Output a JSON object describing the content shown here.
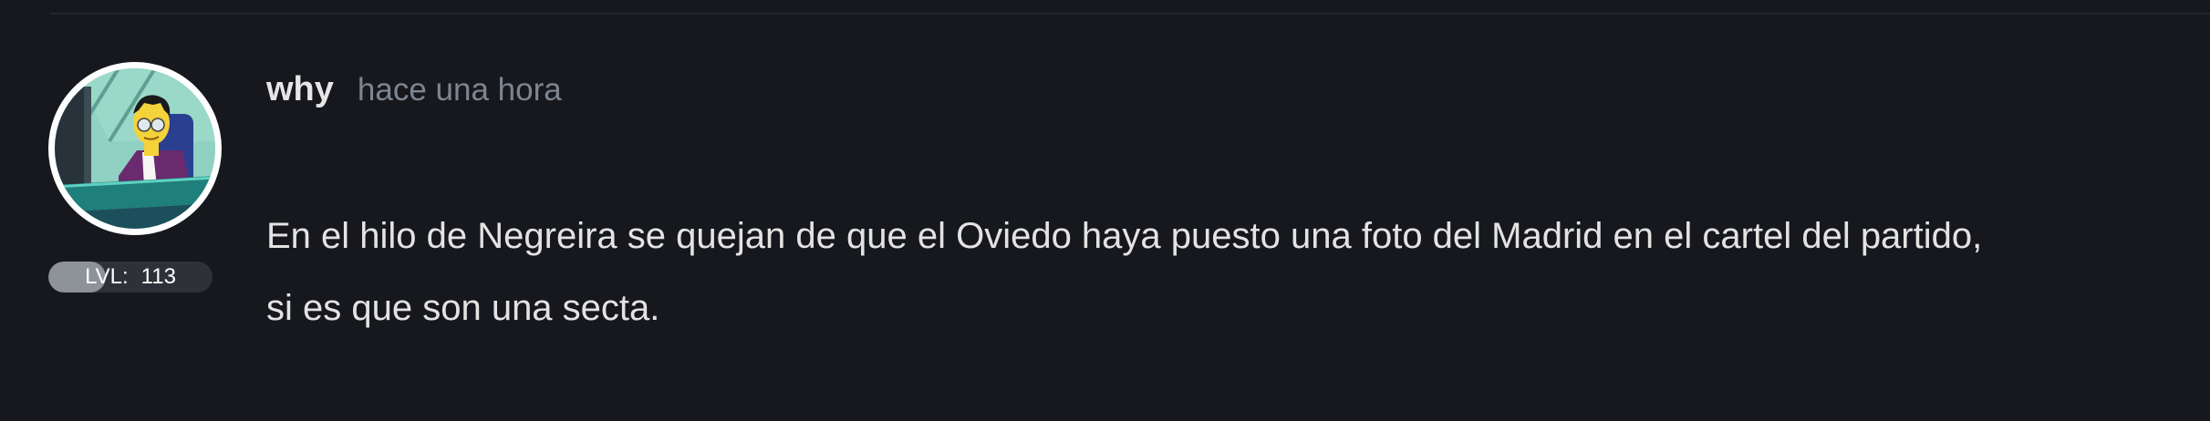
{
  "post": {
    "author": {
      "name": "why",
      "avatar_icon": "simpsons-character-avatar-icon",
      "level_label": "LVL:",
      "level_value": "113",
      "level_progress": 0.35
    },
    "timestamp": "hace una hora",
    "message_lines": [
      "En el hilo de Negreira se quejan de que el Oviedo haya puesto una foto del Madrid en el cartel del partido,",
      "si es que son una secta."
    ]
  },
  "colors": {
    "background": "#16181d",
    "username": "#e6e6e6",
    "timestamp": "#7d8591",
    "message_text": "#e3e3e3",
    "level_badge_bg": "#2e3137",
    "level_badge_fill": "#8e9299",
    "avatar_border": "#ffffff"
  }
}
